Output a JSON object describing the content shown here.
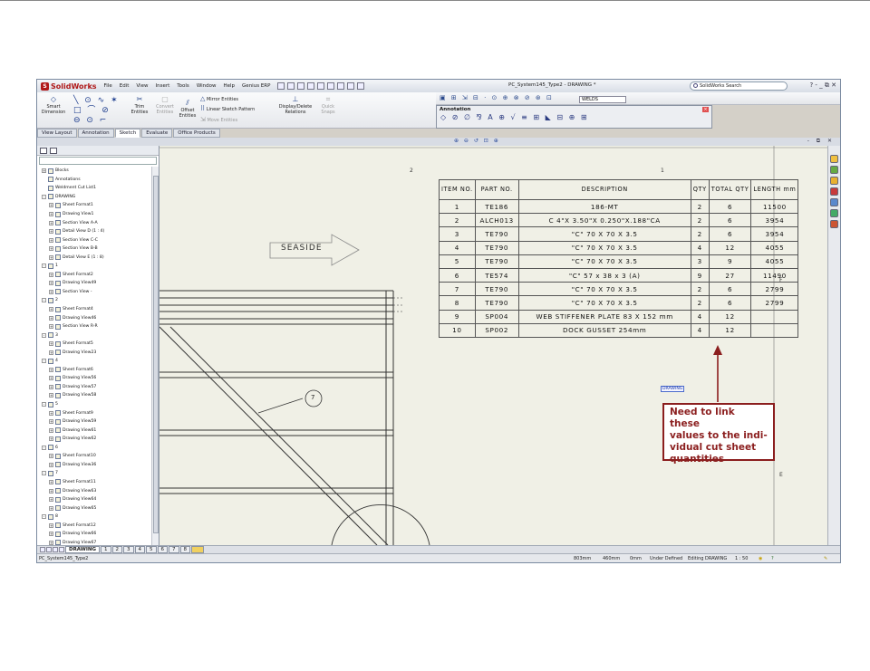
{
  "app": {
    "logo": "SolidWorks",
    "menu": [
      "File",
      "Edit",
      "View",
      "Insert",
      "Tools",
      "Window",
      "Help",
      "Genius ERP"
    ],
    "document_title": "PC_System145_Type2 - DRAWING *",
    "search_placeholder": "SolidWorks Search",
    "window_controls": "? - _ ⧉ ✕"
  },
  "commandmanager": {
    "commands": [
      {
        "label": "Smart\nDimension",
        "icon": "smart-dimension-icon"
      },
      {
        "label": "Trim\nEntities",
        "icon": "trim-icon"
      },
      {
        "label": "Convert\nEntities",
        "icon": "convert-icon"
      },
      {
        "label": "Offset\nEntities",
        "icon": "offset-icon"
      },
      {
        "label": "Mirror Entities",
        "icon": "mirror-icon"
      },
      {
        "label": "Linear Sketch Pattern",
        "icon": "pattern-icon"
      },
      {
        "label": "Move Entities",
        "icon": "move-icon"
      },
      {
        "label": "Display/Delete\nRelations",
        "icon": "relations-icon"
      },
      {
        "label": "Quick\nSnaps",
        "icon": "snaps-icon"
      }
    ],
    "tabs": [
      "View Layout",
      "Annotation",
      "Sketch",
      "Evaluate",
      "Office Products"
    ],
    "active_tab": "Sketch"
  },
  "annotation_toolbar": {
    "title": "Annotation",
    "welds_value": "WELDS"
  },
  "feature_tree": [
    {
      "level": 0,
      "label": "Blocks",
      "exp": "+"
    },
    {
      "level": 0,
      "label": "Annotations",
      "exp": ""
    },
    {
      "level": 0,
      "label": "Weldment Cut List1",
      "exp": ""
    },
    {
      "level": 0,
      "label": "DRAWING",
      "exp": "-"
    },
    {
      "level": 1,
      "label": "Sheet Format1",
      "exp": "+"
    },
    {
      "level": 1,
      "label": "Drawing View1",
      "exp": "+"
    },
    {
      "level": 1,
      "label": "Section View A-A",
      "exp": "+"
    },
    {
      "level": 1,
      "label": "Detail View D (1 : 4)",
      "exp": "+"
    },
    {
      "level": 1,
      "label": "Section View C-C",
      "exp": "+"
    },
    {
      "level": 1,
      "label": "Section View B-B",
      "exp": "+"
    },
    {
      "level": 1,
      "label": "Detail View E (1 : 8)",
      "exp": "+"
    },
    {
      "level": 0,
      "label": "1",
      "exp": "-"
    },
    {
      "level": 1,
      "label": "Sheet Format2",
      "exp": "+"
    },
    {
      "level": 1,
      "label": "Drawing View49",
      "exp": "+"
    },
    {
      "level": 1,
      "label": "Section View -",
      "exp": "+"
    },
    {
      "level": 0,
      "label": "2",
      "exp": "-"
    },
    {
      "level": 1,
      "label": "Sheet Format4",
      "exp": "+"
    },
    {
      "level": 1,
      "label": "Drawing View46",
      "exp": "+"
    },
    {
      "level": 1,
      "label": "Section View R-R",
      "exp": "+"
    },
    {
      "level": 0,
      "label": "3",
      "exp": "-"
    },
    {
      "level": 1,
      "label": "Sheet Format5",
      "exp": "+"
    },
    {
      "level": 1,
      "label": "Drawing View23",
      "exp": "+"
    },
    {
      "level": 0,
      "label": "4",
      "exp": "-"
    },
    {
      "level": 1,
      "label": "Sheet Format6",
      "exp": "+"
    },
    {
      "level": 1,
      "label": "Drawing View56",
      "exp": "+"
    },
    {
      "level": 1,
      "label": "Drawing View57",
      "exp": "+"
    },
    {
      "level": 1,
      "label": "Drawing View58",
      "exp": "+"
    },
    {
      "level": 0,
      "label": "5",
      "exp": "-"
    },
    {
      "level": 1,
      "label": "Sheet Format9",
      "exp": "+"
    },
    {
      "level": 1,
      "label": "Drawing View59",
      "exp": "+"
    },
    {
      "level": 1,
      "label": "Drawing View61",
      "exp": "+"
    },
    {
      "level": 1,
      "label": "Drawing View62",
      "exp": "+"
    },
    {
      "level": 0,
      "label": "6",
      "exp": "-"
    },
    {
      "level": 1,
      "label": "Sheet Format10",
      "exp": "+"
    },
    {
      "level": 1,
      "label": "Drawing View36",
      "exp": "+"
    },
    {
      "level": 0,
      "label": "7",
      "exp": "-"
    },
    {
      "level": 1,
      "label": "Sheet Format11",
      "exp": "+"
    },
    {
      "level": 1,
      "label": "Drawing View63",
      "exp": "+"
    },
    {
      "level": 1,
      "label": "Drawing View64",
      "exp": "+"
    },
    {
      "level": 1,
      "label": "Drawing View65",
      "exp": "+"
    },
    {
      "level": 0,
      "label": "8",
      "exp": "-"
    },
    {
      "level": 1,
      "label": "Sheet Format12",
      "exp": "+"
    },
    {
      "level": 1,
      "label": "Drawing View66",
      "exp": "+"
    },
    {
      "level": 1,
      "label": "Drawing View67",
      "exp": "+"
    }
  ],
  "drawing": {
    "zone_top": [
      "2",
      "1"
    ],
    "zone_right": [
      "F",
      "E"
    ],
    "seaside_label": "SEASIDE",
    "balloon": "7",
    "drawing_tag": "DRAWING"
  },
  "bom": {
    "headers": [
      "ITEM NO.",
      "PART NO.",
      "DESCRIPTION",
      "QTY",
      "TOTAL QTY",
      "LENGTH mm"
    ],
    "rows": [
      [
        "1",
        "TE186",
        "186-MT",
        "2",
        "6",
        "11500"
      ],
      [
        "2",
        "ALCH013",
        "C 4\"X 3.50\"X 0.250\"X.188\"CA",
        "2",
        "6",
        "3954"
      ],
      [
        "3",
        "TE790",
        "\"C\" 70 X 70 X 3.5",
        "2",
        "6",
        "3954"
      ],
      [
        "4",
        "TE790",
        "\"C\" 70 X 70 X 3.5",
        "4",
        "12",
        "4055"
      ],
      [
        "5",
        "TE790",
        "\"C\" 70 X 70 X 3.5",
        "3",
        "9",
        "4055"
      ],
      [
        "6",
        "TE574",
        "\"C\" 57 x 38 x 3 (A)",
        "9",
        "27",
        "11490"
      ],
      [
        "7",
        "TE790",
        "\"C\" 70 X 70 X 3.5",
        "2",
        "6",
        "2799"
      ],
      [
        "8",
        "TE790",
        "\"C\" 70 X 70 X 3.5",
        "2",
        "6",
        "2799"
      ],
      [
        "9",
        "SP004",
        "WEB STIFFENER PLATE 83 X 152 mm",
        "4",
        "12",
        ""
      ],
      [
        "10",
        "SP002",
        "DOCK GUSSET 254mm",
        "4",
        "12",
        ""
      ]
    ]
  },
  "callout": {
    "lines": [
      "Need to link these",
      "values to the indi-",
      "vidual cut sheet",
      "quantities"
    ],
    "color": "#8b1e1e"
  },
  "sheet_tabs": [
    "DRAWING",
    "1",
    "2",
    "3",
    "4",
    "5",
    "6",
    "7",
    "8"
  ],
  "active_sheet": "DRAWING",
  "status": {
    "doc_name": "PC_System145_Type2",
    "x": "803mm",
    "y": "460mm",
    "z": "0mm",
    "state": "Under Defined",
    "editing": "Editing DRAWING",
    "scale": "1 : 50"
  }
}
